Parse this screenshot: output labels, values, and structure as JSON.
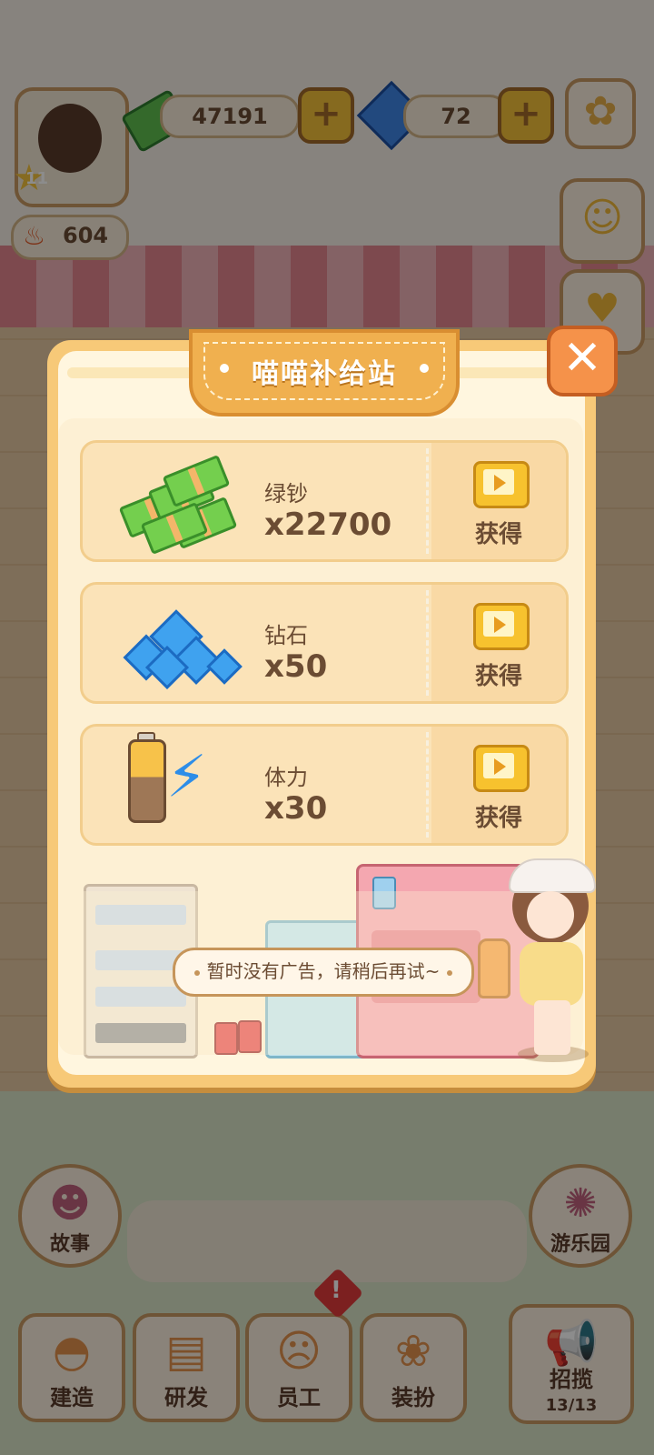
{
  "hud": {
    "cash_amount": "47191",
    "gem_amount": "72",
    "energy_amount": "604",
    "player_level": "11"
  },
  "dialog": {
    "title": "喵喵补给站",
    "close_label": "✕",
    "items": [
      {
        "name": "绿钞",
        "quantity": "x22700",
        "action_label": "获得",
        "icon": "cash-stack-icon"
      },
      {
        "name": "钻石",
        "quantity": "x50",
        "action_label": "获得",
        "icon": "diamond-pile-icon"
      },
      {
        "name": "体力",
        "quantity": "x30",
        "action_label": "获得",
        "icon": "battery-bolt-icon"
      }
    ],
    "toast_message": "暂时没有广告，请稍后再试~"
  },
  "bottom_nav": {
    "story": "故事",
    "build": "建造",
    "research": "研发",
    "staff": "员工",
    "decorate": "装扮",
    "recruit": "招揽",
    "recruit_count": "13/13",
    "amusement_park": "游乐园"
  },
  "colors": {
    "dialog_frame": "#f7c978",
    "title_tab": "#f0b04f",
    "close_button": "#f5924a",
    "item_card": "#fbe3b8",
    "text_brown": "#6b4c33"
  }
}
